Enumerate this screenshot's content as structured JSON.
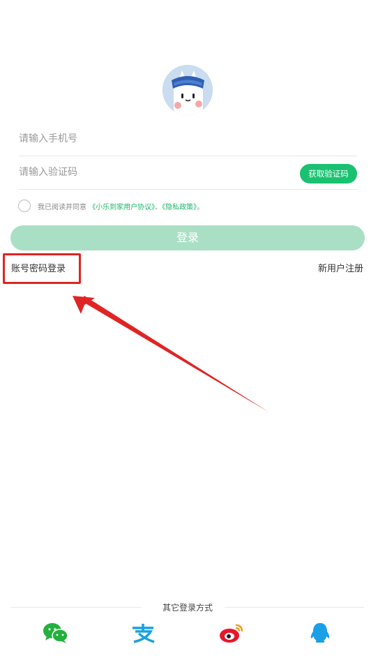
{
  "form": {
    "phone_placeholder": "请输入手机号",
    "code_placeholder": "请输入验证码",
    "get_code_label": "获取验证码"
  },
  "agreement": {
    "prefix": "我已阅读并同意",
    "user_agreement": "《小乐到家用户协议》",
    "separator": "、",
    "privacy_policy": "《隐私政策》",
    "suffix": "。"
  },
  "login_button": "登录",
  "password_login": "账号密码登录",
  "register": "新用户注册",
  "other_login": {
    "title": "其它登录方式",
    "methods": [
      "wechat-icon",
      "alipay-icon",
      "weibo-icon",
      "qq-icon"
    ]
  },
  "colors": {
    "accent": "#1ac170",
    "login_button_disabled": "#a9dfc5",
    "annotation_red": "#e02424"
  }
}
